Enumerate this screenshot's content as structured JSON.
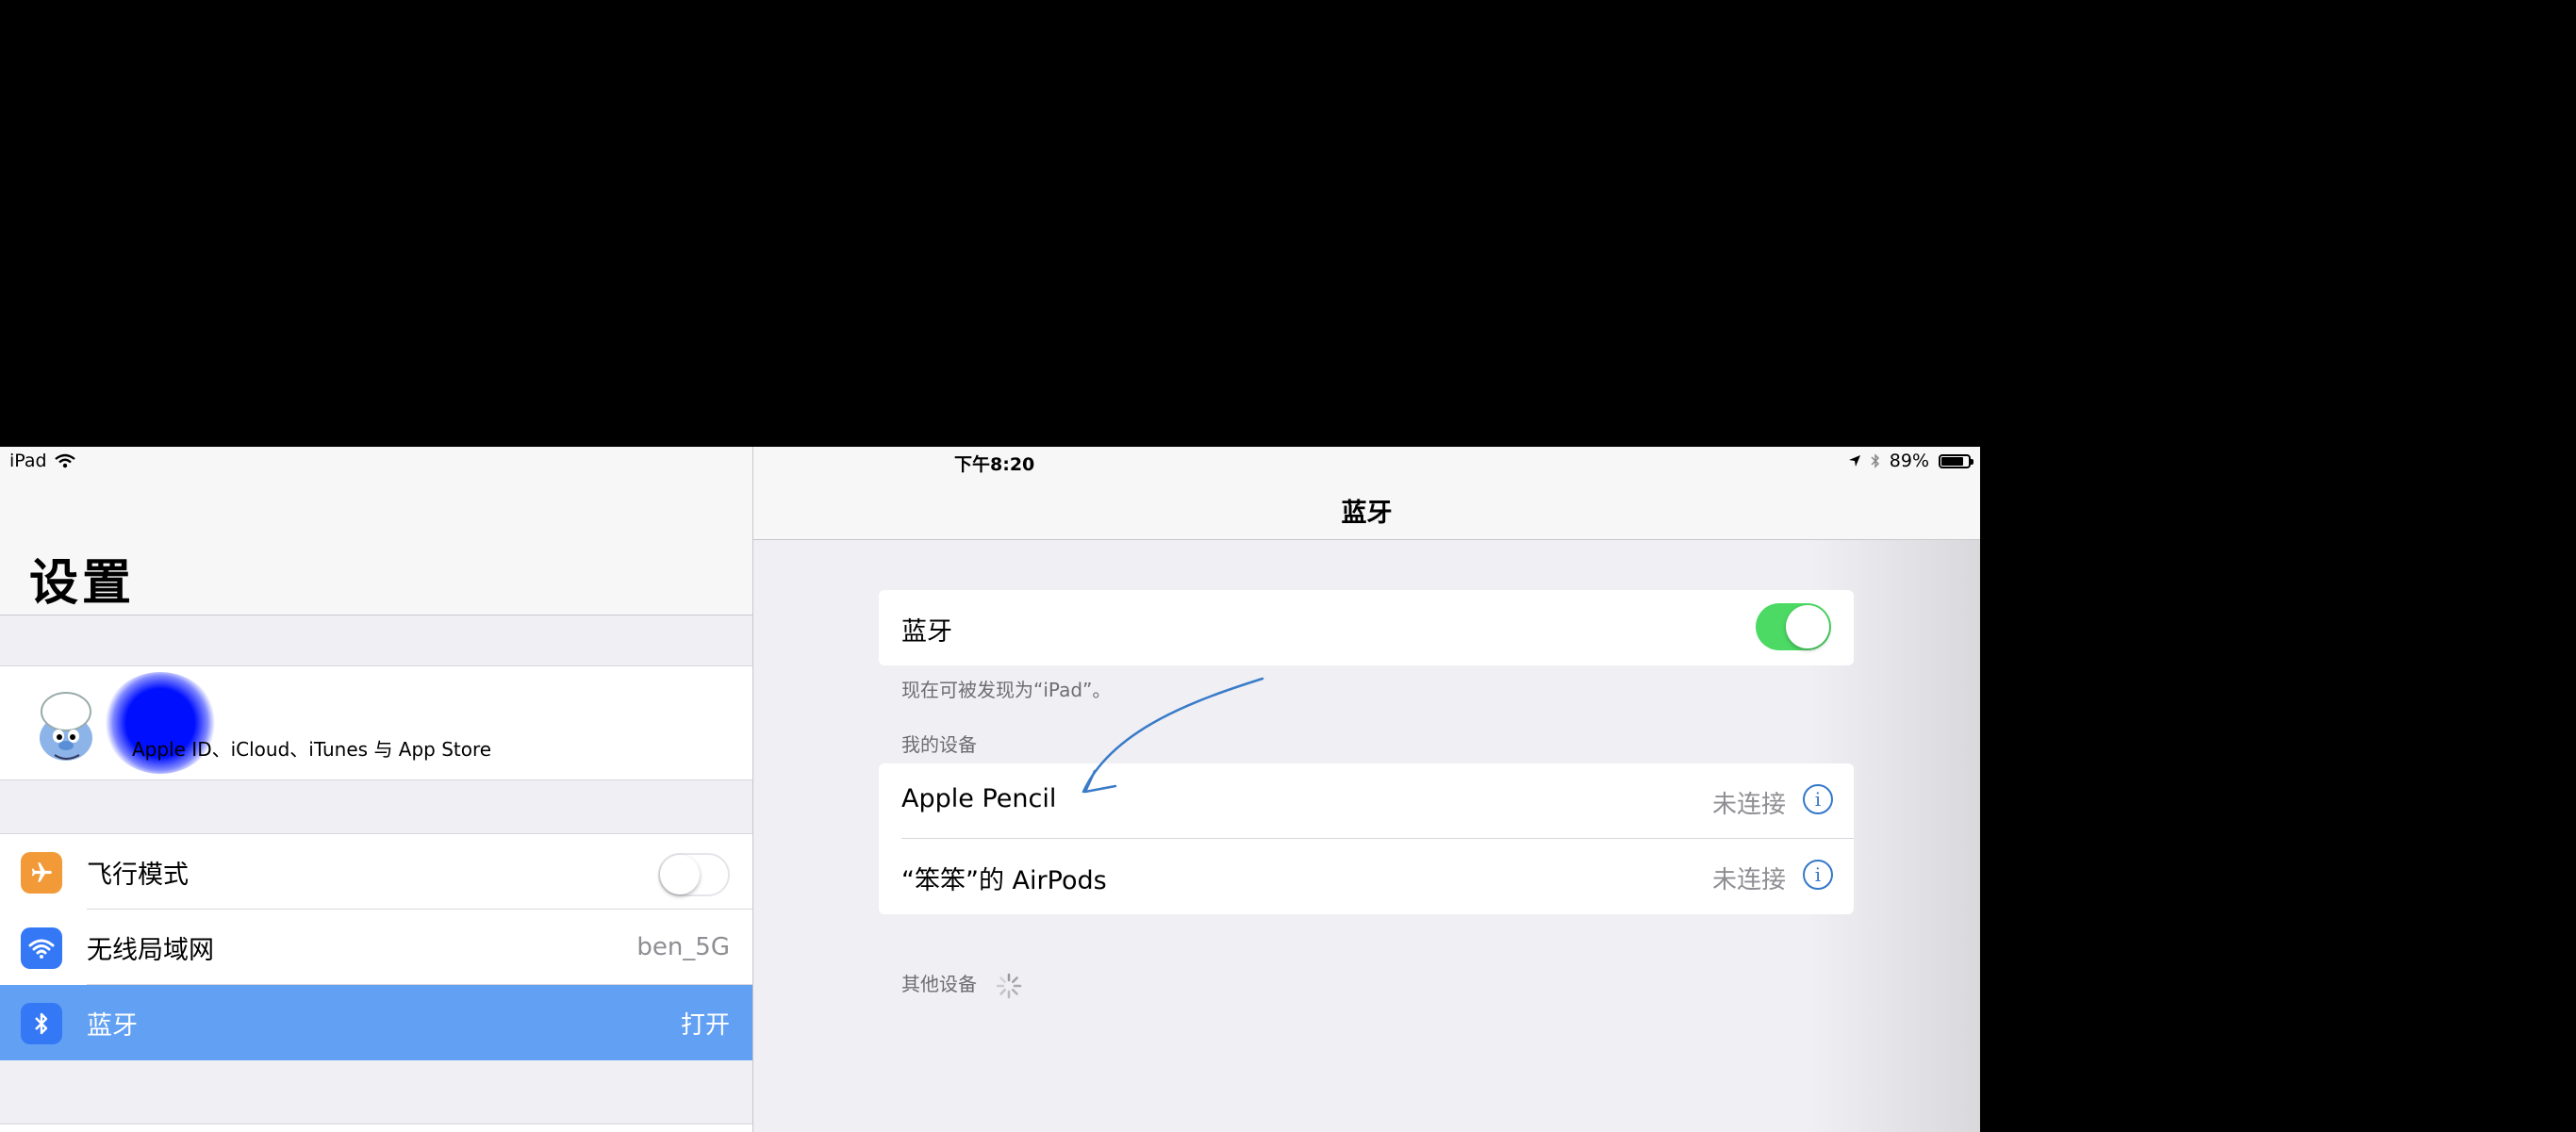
{
  "status_bar": {
    "device": "iPad",
    "time": "下午8:20",
    "battery_percent": "89%",
    "battery_level": 0.89
  },
  "sidebar": {
    "title": "设置",
    "account_subtitle": "Apple ID、iCloud、iTunes 与 App Store",
    "items": [
      {
        "label": "飞行模式",
        "value": "",
        "icon": "airplane-icon",
        "icon_color": "#f19a37",
        "toggle": false
      },
      {
        "label": "无线局域网",
        "value": "ben_5G",
        "icon": "wifi-icon",
        "icon_color": "#3478f6"
      },
      {
        "label": "蓝牙",
        "value": "打开",
        "icon": "bluetooth-icon",
        "icon_color": "#3478f6",
        "selected": true
      }
    ]
  },
  "detail": {
    "nav_title": "蓝牙",
    "bluetooth_label": "蓝牙",
    "bluetooth_on": true,
    "discoverable_text": "现在可被发现为“iPad”。",
    "my_devices_header": "我的设备",
    "devices": [
      {
        "name": "Apple Pencil",
        "status": "未连接"
      },
      {
        "name": "“笨笨”的 AirPods",
        "status": "未连接"
      }
    ],
    "other_devices_header": "其他设备"
  },
  "colors": {
    "accent": "#3478f6",
    "selected_row": "#62a0f3",
    "switch_on": "#4cd964"
  }
}
